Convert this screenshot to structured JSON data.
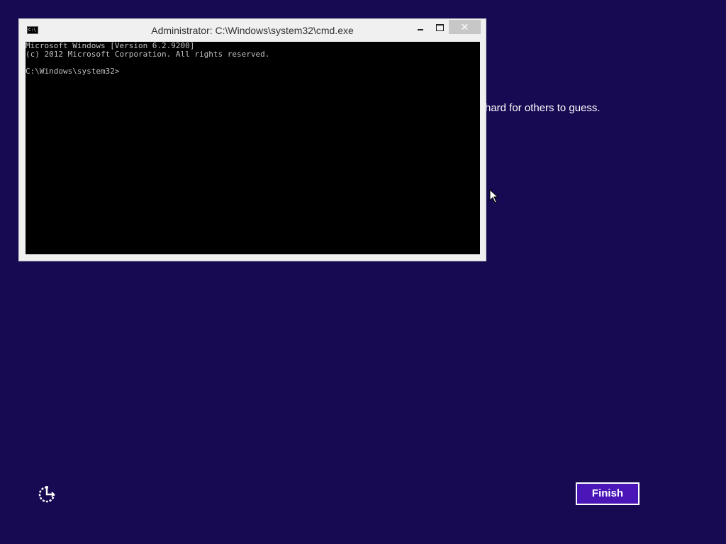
{
  "background": {
    "color": "#180a52",
    "partial_text": "hard for others to guess."
  },
  "cmd_window": {
    "title": "Administrator: C:\\Windows\\system32\\cmd.exe",
    "icon": "cmd-icon",
    "icon_text": "C:\\",
    "controls": {
      "minimize_icon": "minimize-icon",
      "maximize_icon": "maximize-icon",
      "close_glyph": "✕"
    },
    "console": {
      "background": "#000000",
      "text_color": "#c0c0c0",
      "lines": [
        "Microsoft Windows [Version 6.2.9200]",
        "(c) 2012 Microsoft Corporation. All rights reserved.",
        "",
        "C:\\Windows\\system32>"
      ]
    }
  },
  "footer": {
    "ease_of_access_icon": "ease-of-access-icon",
    "finish_label": "Finish",
    "finish_color": "#4a16b8"
  }
}
